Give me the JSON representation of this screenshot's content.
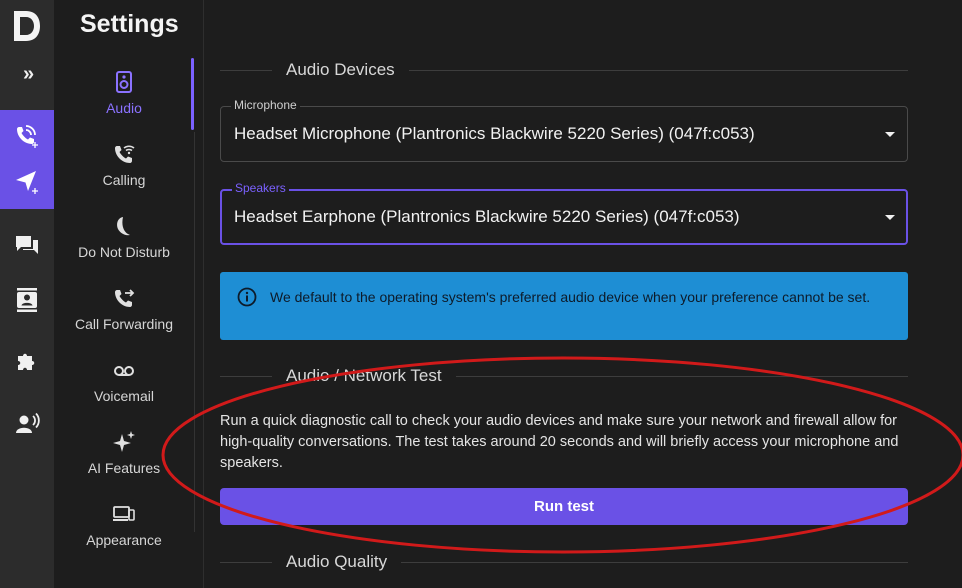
{
  "app": {
    "logo_letter": "D"
  },
  "rail": {
    "items": [
      {
        "name": "expand-icon"
      },
      {
        "name": "call-add-icon"
      },
      {
        "name": "send-add-icon"
      },
      {
        "name": "chat-icon"
      },
      {
        "name": "contacts-icon"
      },
      {
        "name": "puzzle-icon"
      },
      {
        "name": "speaker-person-icon"
      }
    ],
    "expand_label": "»"
  },
  "nav": {
    "title": "Settings",
    "items": [
      {
        "label": "Audio",
        "icon": "speaker-icon",
        "active": true
      },
      {
        "label": "Calling",
        "icon": "wifi-call-icon",
        "active": false
      },
      {
        "label": "Do Not Disturb",
        "icon": "moon-icon",
        "active": false
      },
      {
        "label": "Call Forwarding",
        "icon": "call-forward-icon",
        "active": false
      },
      {
        "label": "Voicemail",
        "icon": "voicemail-icon",
        "active": false
      },
      {
        "label": "AI Features",
        "icon": "sparkle-icon",
        "active": false
      },
      {
        "label": "Appearance",
        "icon": "devices-icon",
        "active": false
      }
    ]
  },
  "main": {
    "audio_devices": {
      "heading": "Audio Devices",
      "microphone": {
        "label": "Microphone",
        "value": "Headset Microphone (Plantronics Blackwire 5220 Series) (047f:c053)"
      },
      "speakers": {
        "label": "Speakers",
        "value": "Headset Earphone (Plantronics Blackwire 5220 Series) (047f:c053)"
      },
      "info": "We default to the operating system's preferred audio device when your preference cannot be set."
    },
    "network_test": {
      "heading": "Audio / Network Test",
      "description": "Run a quick diagnostic call to check your audio devices and make sure your network and firewall allow for high-quality conversations. The test takes around 20 seconds and will briefly access your microphone and speakers.",
      "button": "Run test"
    },
    "audio_quality": {
      "heading": "Audio Quality"
    }
  },
  "colors": {
    "accent": "#6a51e6",
    "info": "#1e8ed4",
    "annotation": "#d11a1a"
  }
}
